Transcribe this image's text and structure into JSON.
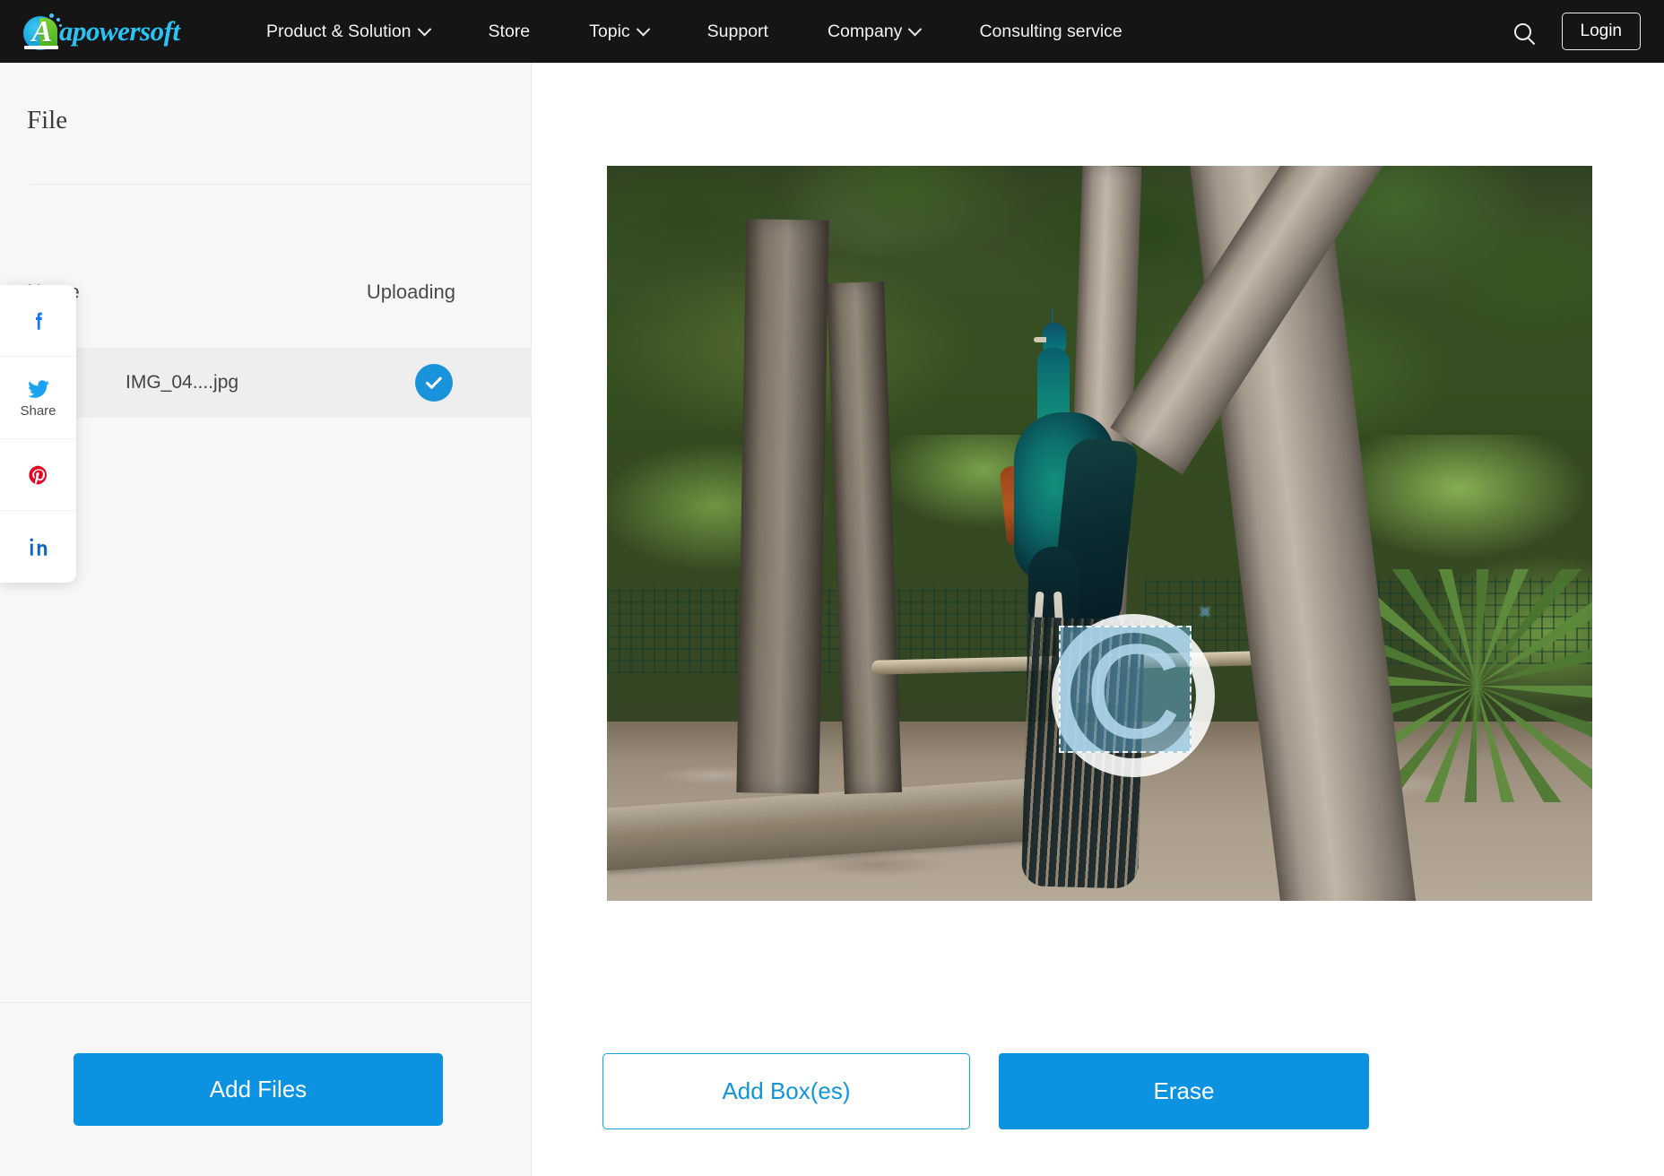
{
  "topnav": {
    "logo": {
      "icon": "apowersoft-logo-icon",
      "letter": "A",
      "wordmark": "apowersoft"
    },
    "links": [
      {
        "label": "Product & Solution",
        "has_dropdown": true
      },
      {
        "label": "Store",
        "has_dropdown": false
      },
      {
        "label": "Topic",
        "has_dropdown": true
      },
      {
        "label": "Support",
        "has_dropdown": false
      },
      {
        "label": "Company",
        "has_dropdown": true
      },
      {
        "label": "Consulting service",
        "has_dropdown": false
      }
    ],
    "search_icon": "search-icon",
    "login_label": "Login"
  },
  "sidebar": {
    "title": "File",
    "columns": {
      "name": "Name",
      "status": "Uploading"
    },
    "files": [
      {
        "name": "IMG_04....jpg",
        "status_icon": "check-circle-icon",
        "status": "done"
      }
    ],
    "add_files_label": "Add Files"
  },
  "share_widget": {
    "items": [
      {
        "network": "facebook",
        "icon": "facebook-icon",
        "label": ""
      },
      {
        "network": "twitter",
        "icon": "twitter-icon",
        "label": "Share"
      },
      {
        "network": "pinterest",
        "icon": "pinterest-icon",
        "label": ""
      },
      {
        "network": "linkedin",
        "icon": "linkedin-icon",
        "label": ""
      }
    ]
  },
  "main": {
    "photo": {
      "alt": "Peacock perched on a wooden rail under trees in a park enclosure",
      "watermark": {
        "glyph": "C",
        "type": "copyright-watermark"
      }
    },
    "selection_box": {
      "close_label": "×"
    },
    "add_box_label": "Add Box(es)",
    "erase_label": "Erase"
  },
  "colors": {
    "nav_background": "#151515",
    "accent_blue": "#0b93e1",
    "logo_cyan": "#29c4f5",
    "sidebar_background": "#f7f7f7",
    "row_highlight": "#eeeeee",
    "check_blue": "#1a93dd",
    "selection_fill": "#64afd7",
    "facebook": "#1877f2",
    "twitter": "#1da1f2",
    "pinterest": "#e60023",
    "linkedin": "#0a66c2"
  }
}
